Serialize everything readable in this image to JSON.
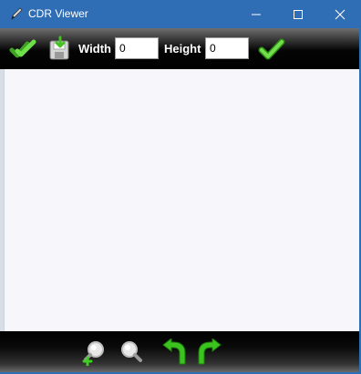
{
  "window": {
    "title": "CDR Viewer",
    "icon": "pen-icon"
  },
  "toolbar": {
    "width_label": "Width",
    "width_value": "0",
    "height_label": "Height",
    "height_value": "0",
    "icons": [
      "double-check-icon",
      "save-icon",
      "apply-check-icon"
    ]
  },
  "bottombar": {
    "icons": [
      "zoom-in-icon",
      "zoom-out-icon",
      "rotate-left-icon",
      "rotate-right-icon"
    ]
  },
  "colors": {
    "titlebar": "#2f6db5",
    "check_green": "#5fd23a",
    "canvas": "#f7f7fb"
  }
}
